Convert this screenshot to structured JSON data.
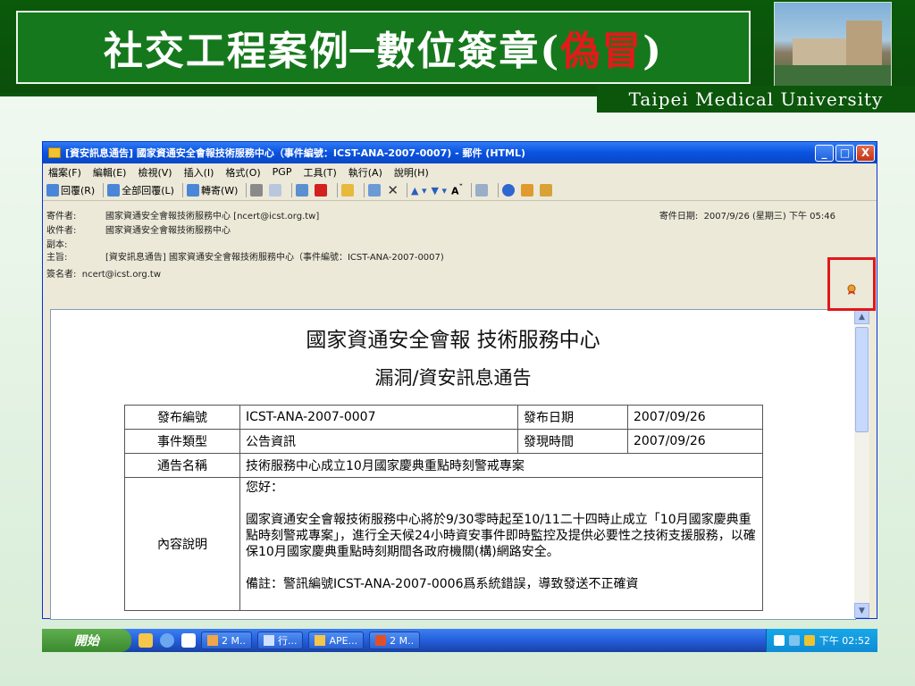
{
  "slide": {
    "title_main": "社交工程案例─數位簽章(",
    "title_red": "偽冒",
    "title_end": ")",
    "university": "Taipei Medical University"
  },
  "window": {
    "title": "[資安訊息通告] 國家資通安全會報技術服務中心（事件編號：ICST-ANA-2007-0007) - 郵件 (HTML)",
    "controls": [
      "_",
      "□",
      "X"
    ],
    "menu": [
      "檔案(F)",
      "編輯(E)",
      "檢視(V)",
      "插入(I)",
      "格式(O)",
      "PGP",
      "工具(T)",
      "執行(A)",
      "說明(H)"
    ],
    "toolbar": {
      "reply": "回覆(R)",
      "reply_all": "全部回覆(L)",
      "forward": "轉寄(W)"
    }
  },
  "email": {
    "from_label": "寄件者:",
    "from": "國家資通安全會報技術服務中心 [ncert@icst.org.tw]",
    "to_label": "收件者:",
    "to": "國家資通安全會報技術服務中心",
    "cc_label": "副本:",
    "subject_label": "主旨:",
    "subject": "[資安訊息通告] 國家資通安全會報技術服務中心（事件編號：ICST-ANA-2007-0007)",
    "signer_label": "簽名者:",
    "signer": "ncert@icst.org.tw",
    "sent_label": "寄件日期:",
    "sent": "2007/9/26 (星期三) 下午 05:46"
  },
  "document": {
    "heading1": "國家資通安全會報 技術服務中心",
    "heading2": "漏洞/資安訊息通告",
    "rows": [
      {
        "k1": "發布編號",
        "v1": "ICST-ANA-2007-0007",
        "k2": "發布日期",
        "v2": "2007/09/26"
      },
      {
        "k1": "事件類型",
        "v1": "公告資訊",
        "k2": "發現時間",
        "v2": "2007/09/26"
      }
    ],
    "notice_name_label": "通告名稱",
    "notice_name": "技術服務中心成立10月國家慶典重點時刻警戒專案",
    "content_label": "內容說明",
    "content_greeting": "您好：",
    "content_para": "國家資通安全會報技術服務中心將於9/30零時起至10/11二十四時止成立「10月國家慶典重點時刻警戒專案」，進行全天候24小時資安事件即時監控及提供必要性之技術支援服務，以確保10月國家慶典重點時刻期間各政府機關(構)網路安全。",
    "content_note": "備註：警訊編號ICST-ANA-2007-0006爲系統錯誤，導致發送不正確資"
  },
  "taskbar": {
    "start": "開始",
    "tasks": [
      "2 M..",
      "行...",
      "APE...",
      "2 M.."
    ],
    "clock": "下午 02:52"
  }
}
